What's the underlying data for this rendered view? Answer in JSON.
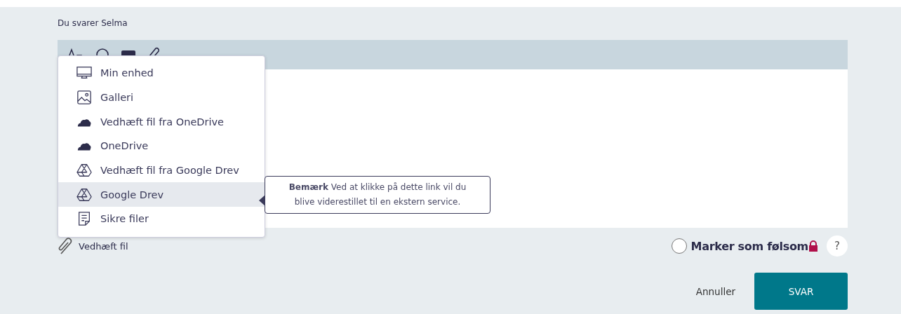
{
  "reply_to": "Du svarer Selma",
  "attach_menu": [
    {
      "kind": "device",
      "label": "Min enhed",
      "selected": false
    },
    {
      "kind": "gallery",
      "label": "Galleri",
      "selected": false
    },
    {
      "kind": "cloud",
      "label": "Vedhæft fil fra OneDrive",
      "selected": false
    },
    {
      "kind": "cloud",
      "label": "OneDrive",
      "selected": false
    },
    {
      "kind": "drive",
      "label": "Vedhæft fil fra Google Drev",
      "selected": false
    },
    {
      "kind": "drive",
      "label": "Google Drev",
      "selected": true
    },
    {
      "kind": "file",
      "label": "Sikre filer",
      "selected": false
    }
  ],
  "tooltip": "**Bemærk** Ved at klikke på dette link vil du blive viderestillet til en ekstern service.",
  "attach_label": "Vedhæft fil",
  "sensitive": {
    "label": "Marker som følsom",
    "checked": false
  },
  "help": "?",
  "buttons": {
    "cancel": "Annuller",
    "submit": "SVAR"
  }
}
